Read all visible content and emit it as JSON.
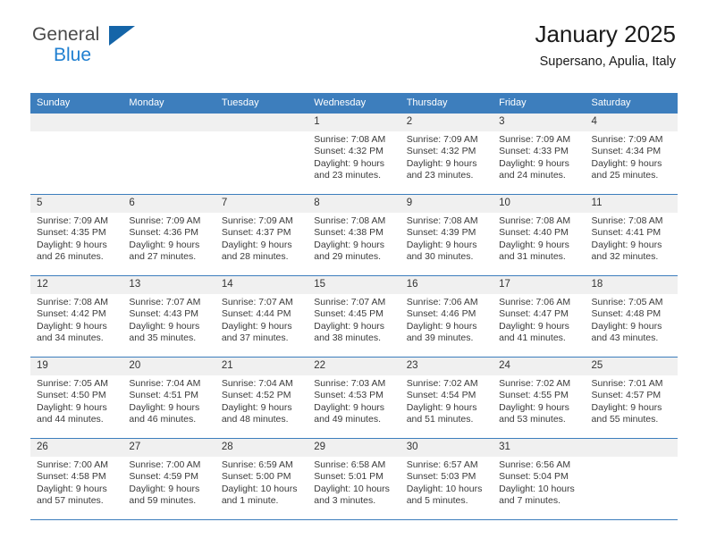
{
  "brand": {
    "name_top": "General",
    "name_bottom": "Blue"
  },
  "header": {
    "title": "January 2025",
    "location": "Supersano, Apulia, Italy"
  },
  "colors": {
    "header_blue": "#3d7ebd",
    "logo_blue": "#1f7fd0",
    "daynum_band": "#f0f0f0"
  },
  "weekdays": [
    "Sunday",
    "Monday",
    "Tuesday",
    "Wednesday",
    "Thursday",
    "Friday",
    "Saturday"
  ],
  "weeks": [
    [
      {
        "day": "",
        "lines": []
      },
      {
        "day": "",
        "lines": []
      },
      {
        "day": "",
        "lines": []
      },
      {
        "day": "1",
        "lines": [
          "Sunrise: 7:08 AM",
          "Sunset: 4:32 PM",
          "Daylight: 9 hours",
          "and 23 minutes."
        ]
      },
      {
        "day": "2",
        "lines": [
          "Sunrise: 7:09 AM",
          "Sunset: 4:32 PM",
          "Daylight: 9 hours",
          "and 23 minutes."
        ]
      },
      {
        "day": "3",
        "lines": [
          "Sunrise: 7:09 AM",
          "Sunset: 4:33 PM",
          "Daylight: 9 hours",
          "and 24 minutes."
        ]
      },
      {
        "day": "4",
        "lines": [
          "Sunrise: 7:09 AM",
          "Sunset: 4:34 PM",
          "Daylight: 9 hours",
          "and 25 minutes."
        ]
      }
    ],
    [
      {
        "day": "5",
        "lines": [
          "Sunrise: 7:09 AM",
          "Sunset: 4:35 PM",
          "Daylight: 9 hours",
          "and 26 minutes."
        ]
      },
      {
        "day": "6",
        "lines": [
          "Sunrise: 7:09 AM",
          "Sunset: 4:36 PM",
          "Daylight: 9 hours",
          "and 27 minutes."
        ]
      },
      {
        "day": "7",
        "lines": [
          "Sunrise: 7:09 AM",
          "Sunset: 4:37 PM",
          "Daylight: 9 hours",
          "and 28 minutes."
        ]
      },
      {
        "day": "8",
        "lines": [
          "Sunrise: 7:08 AM",
          "Sunset: 4:38 PM",
          "Daylight: 9 hours",
          "and 29 minutes."
        ]
      },
      {
        "day": "9",
        "lines": [
          "Sunrise: 7:08 AM",
          "Sunset: 4:39 PM",
          "Daylight: 9 hours",
          "and 30 minutes."
        ]
      },
      {
        "day": "10",
        "lines": [
          "Sunrise: 7:08 AM",
          "Sunset: 4:40 PM",
          "Daylight: 9 hours",
          "and 31 minutes."
        ]
      },
      {
        "day": "11",
        "lines": [
          "Sunrise: 7:08 AM",
          "Sunset: 4:41 PM",
          "Daylight: 9 hours",
          "and 32 minutes."
        ]
      }
    ],
    [
      {
        "day": "12",
        "lines": [
          "Sunrise: 7:08 AM",
          "Sunset: 4:42 PM",
          "Daylight: 9 hours",
          "and 34 minutes."
        ]
      },
      {
        "day": "13",
        "lines": [
          "Sunrise: 7:07 AM",
          "Sunset: 4:43 PM",
          "Daylight: 9 hours",
          "and 35 minutes."
        ]
      },
      {
        "day": "14",
        "lines": [
          "Sunrise: 7:07 AM",
          "Sunset: 4:44 PM",
          "Daylight: 9 hours",
          "and 37 minutes."
        ]
      },
      {
        "day": "15",
        "lines": [
          "Sunrise: 7:07 AM",
          "Sunset: 4:45 PM",
          "Daylight: 9 hours",
          "and 38 minutes."
        ]
      },
      {
        "day": "16",
        "lines": [
          "Sunrise: 7:06 AM",
          "Sunset: 4:46 PM",
          "Daylight: 9 hours",
          "and 39 minutes."
        ]
      },
      {
        "day": "17",
        "lines": [
          "Sunrise: 7:06 AM",
          "Sunset: 4:47 PM",
          "Daylight: 9 hours",
          "and 41 minutes."
        ]
      },
      {
        "day": "18",
        "lines": [
          "Sunrise: 7:05 AM",
          "Sunset: 4:48 PM",
          "Daylight: 9 hours",
          "and 43 minutes."
        ]
      }
    ],
    [
      {
        "day": "19",
        "lines": [
          "Sunrise: 7:05 AM",
          "Sunset: 4:50 PM",
          "Daylight: 9 hours",
          "and 44 minutes."
        ]
      },
      {
        "day": "20",
        "lines": [
          "Sunrise: 7:04 AM",
          "Sunset: 4:51 PM",
          "Daylight: 9 hours",
          "and 46 minutes."
        ]
      },
      {
        "day": "21",
        "lines": [
          "Sunrise: 7:04 AM",
          "Sunset: 4:52 PM",
          "Daylight: 9 hours",
          "and 48 minutes."
        ]
      },
      {
        "day": "22",
        "lines": [
          "Sunrise: 7:03 AM",
          "Sunset: 4:53 PM",
          "Daylight: 9 hours",
          "and 49 minutes."
        ]
      },
      {
        "day": "23",
        "lines": [
          "Sunrise: 7:02 AM",
          "Sunset: 4:54 PM",
          "Daylight: 9 hours",
          "and 51 minutes."
        ]
      },
      {
        "day": "24",
        "lines": [
          "Sunrise: 7:02 AM",
          "Sunset: 4:55 PM",
          "Daylight: 9 hours",
          "and 53 minutes."
        ]
      },
      {
        "day": "25",
        "lines": [
          "Sunrise: 7:01 AM",
          "Sunset: 4:57 PM",
          "Daylight: 9 hours",
          "and 55 minutes."
        ]
      }
    ],
    [
      {
        "day": "26",
        "lines": [
          "Sunrise: 7:00 AM",
          "Sunset: 4:58 PM",
          "Daylight: 9 hours",
          "and 57 minutes."
        ]
      },
      {
        "day": "27",
        "lines": [
          "Sunrise: 7:00 AM",
          "Sunset: 4:59 PM",
          "Daylight: 9 hours",
          "and 59 minutes."
        ]
      },
      {
        "day": "28",
        "lines": [
          "Sunrise: 6:59 AM",
          "Sunset: 5:00 PM",
          "Daylight: 10 hours",
          "and 1 minute."
        ]
      },
      {
        "day": "29",
        "lines": [
          "Sunrise: 6:58 AM",
          "Sunset: 5:01 PM",
          "Daylight: 10 hours",
          "and 3 minutes."
        ]
      },
      {
        "day": "30",
        "lines": [
          "Sunrise: 6:57 AM",
          "Sunset: 5:03 PM",
          "Daylight: 10 hours",
          "and 5 minutes."
        ]
      },
      {
        "day": "31",
        "lines": [
          "Sunrise: 6:56 AM",
          "Sunset: 5:04 PM",
          "Daylight: 10 hours",
          "and 7 minutes."
        ]
      },
      {
        "day": "",
        "lines": []
      }
    ]
  ]
}
